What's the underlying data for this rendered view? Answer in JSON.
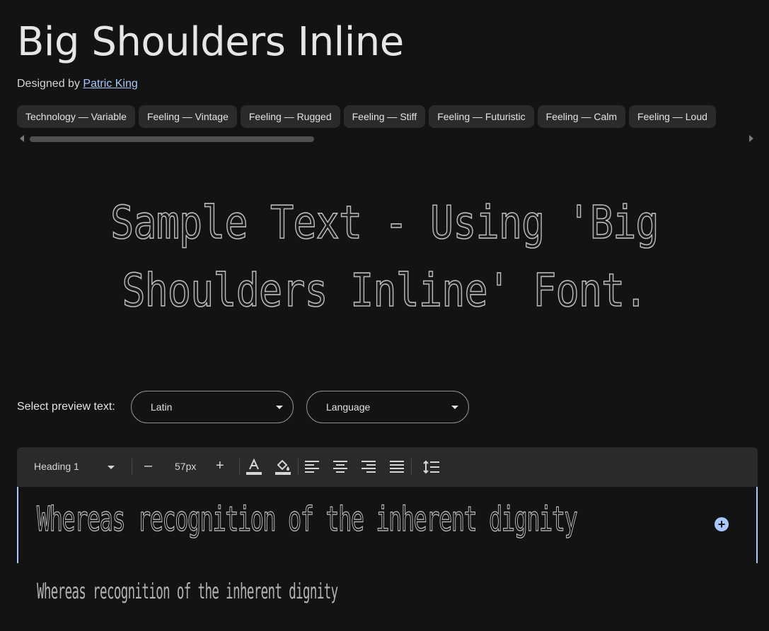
{
  "font": {
    "title": "Big Shoulders Inline",
    "designed_by_label": "Designed by",
    "designer": "Patric King"
  },
  "tags": [
    "Technology — Variable",
    "Feeling — Vintage",
    "Feeling — Rugged",
    "Feeling — Stiff",
    "Feeling — Futuristic",
    "Feeling — Calm",
    "Feeling — Loud"
  ],
  "sample": {
    "text": "Sample Text - Using 'Big Shoulders Inline' Font."
  },
  "preview_select": {
    "label": "Select preview text:",
    "script_value": "Latin",
    "language_value": "Language"
  },
  "toolbar": {
    "style_value": "Heading 1",
    "decrease_label": "–",
    "size_value": "57px",
    "increase_label": "+",
    "text_color_icon": "text-color-icon",
    "fill_color_icon": "fill-color-icon",
    "align_icons": [
      "align-left-icon",
      "align-center-icon",
      "align-right-icon",
      "align-justify-icon"
    ],
    "line_height_icon": "line-height-icon"
  },
  "editor": {
    "heading_text": "Whereas recognition of the inherent dignity",
    "paragraph_text": "Whereas recognition of the inherent dignity",
    "add_icon": "add-circle-icon"
  },
  "colors": {
    "background": "#131313",
    "accent": "#a8c7fa",
    "chip": "#2b2b2b",
    "toolbar": "#2a2a2a"
  }
}
